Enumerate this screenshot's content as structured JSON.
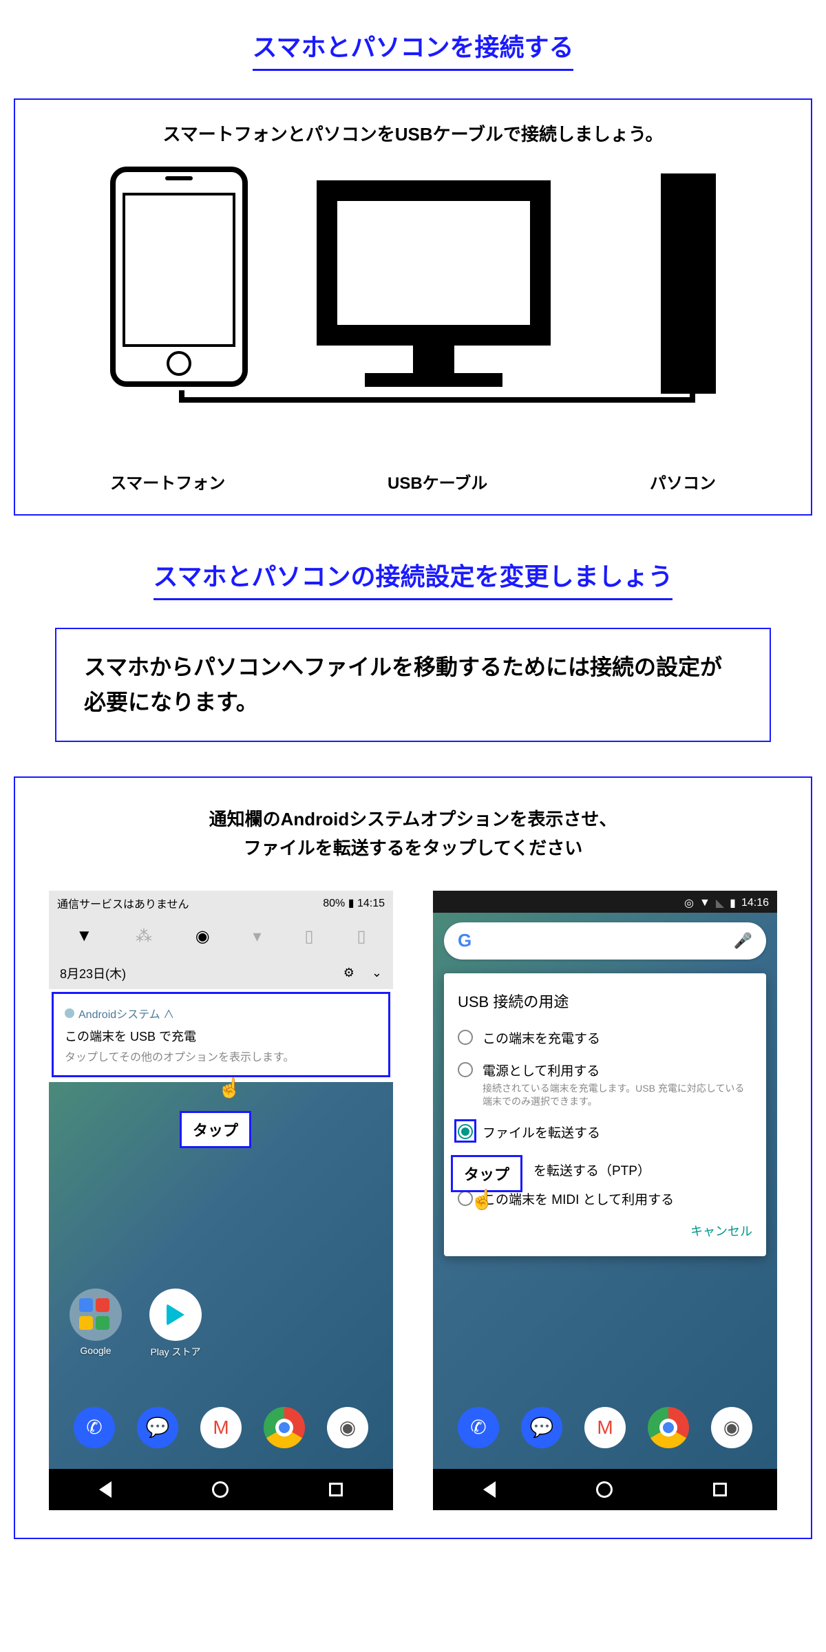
{
  "section1": {
    "title": "スマホとパソコンを接続する",
    "intro": "スマートフォンとパソコンをUSBケーブルで接続しましょう。",
    "label_phone": "スマートフォン",
    "label_cable": "USBケーブル",
    "label_pc": "パソコン"
  },
  "section2": {
    "title": "スマホとパソコンの接続設定を変更しましょう",
    "subtitle": "スマホからパソコンへファイルを移動するためには接続の設定が必要になります。",
    "instruction_l1": "通知欄のAndroidシステムオプションを表示させ、",
    "instruction_l2": "ファイルを転送するをタップしてください"
  },
  "phone1": {
    "status_text": "通信サービスはありません",
    "battery": "80%",
    "time": "14:15",
    "date": "8月23日(木)",
    "notif_app": "Androidシステム ∧",
    "notif_title": "この端末を USB で充電",
    "notif_sub": "タップしてその他のオプションを表示します。",
    "tap_label": "タップ",
    "folder1": "Google",
    "folder2": "Play ストア"
  },
  "phone2": {
    "time": "14:16",
    "dialog_title": "USB 接続の用途",
    "opt1": "この端末を充電する",
    "opt2": "電源として利用する",
    "opt2_desc": "接続されている端末を充電します。USB 充電に対応している端末でのみ選択できます。",
    "opt3": "ファイルを転送する",
    "opt4_suffix": "を転送する（PTP）",
    "opt5": "この端末を MIDI として利用する",
    "cancel": "キャンセル",
    "tap_label": "タップ"
  }
}
